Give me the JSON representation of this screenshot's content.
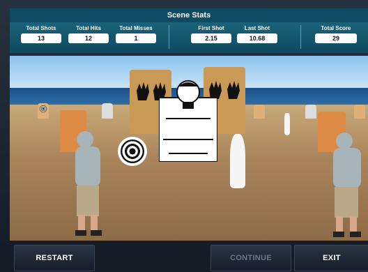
{
  "panel": {
    "title": "Scene Stats"
  },
  "stats": [
    {
      "label": "Total Shots",
      "value": "13"
    },
    {
      "label": "Total Hits",
      "value": "12"
    },
    {
      "label": "Total Misses",
      "value": "1"
    },
    {
      "label": "First Shot",
      "value": "2.15"
    },
    {
      "label": "Last Shot",
      "value": "10.68"
    },
    {
      "label": "Total Score",
      "value": "29"
    }
  ],
  "buttons": {
    "restart": "RESTART",
    "continue": "CONTINUE",
    "exit": "EXIT"
  },
  "colors": {
    "panel": "#1e6e85",
    "button": "#1d2530"
  }
}
